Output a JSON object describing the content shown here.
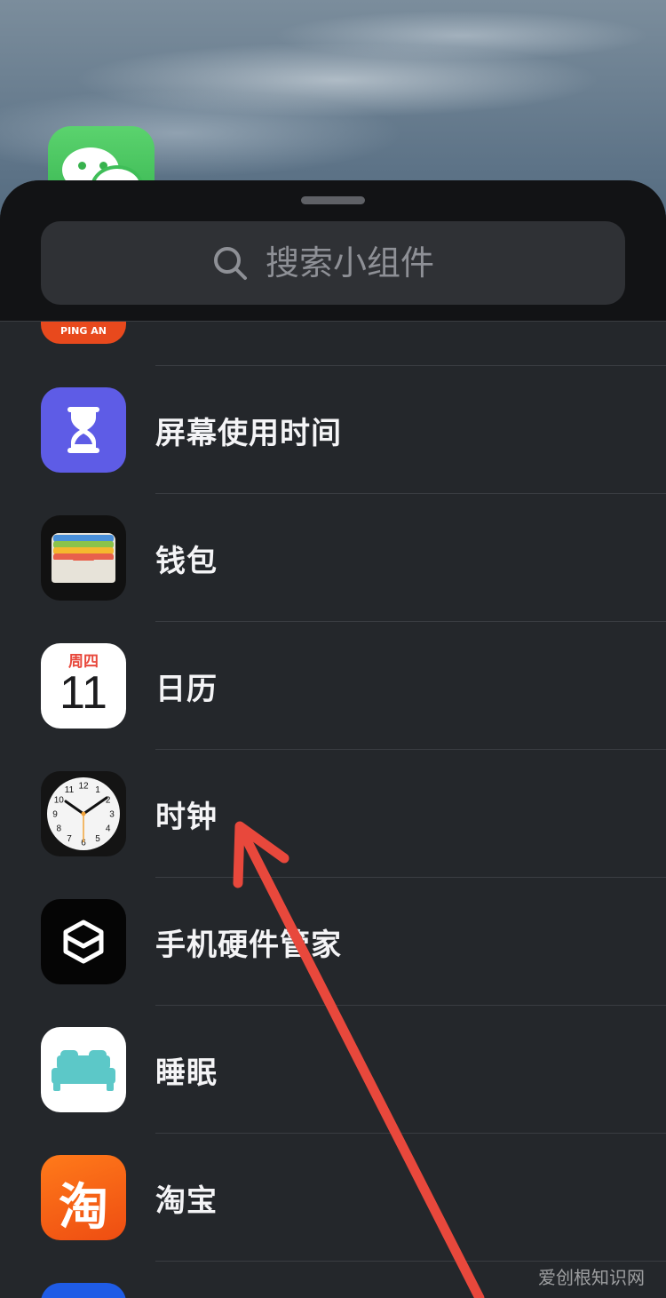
{
  "search": {
    "placeholder": "搜索小组件"
  },
  "apps": [
    {
      "label": "PING AN",
      "icon": "pingan-icon"
    },
    {
      "label": "屏幕使用时间",
      "icon": "hourglass-icon"
    },
    {
      "label": "钱包",
      "icon": "wallet-icon"
    },
    {
      "label": "日历",
      "icon": "calendar-icon",
      "weekday": "周四",
      "day": "11"
    },
    {
      "label": "时钟",
      "icon": "clock-icon",
      "numbers": [
        "12",
        "1",
        "2",
        "3",
        "4",
        "5",
        "6",
        "7",
        "8",
        "9",
        "10",
        "11"
      ]
    },
    {
      "label": "手机硬件管家",
      "icon": "hardware-manager-icon"
    },
    {
      "label": "睡眠",
      "icon": "bed-icon"
    },
    {
      "label": "淘宝",
      "icon": "taobao-icon",
      "glyph": "淘"
    }
  ],
  "watermark": "爱创根知识网",
  "colors": {
    "accent_red": "#e8483c",
    "sheet_bg": "#24272b",
    "header_bg": "#121315"
  }
}
